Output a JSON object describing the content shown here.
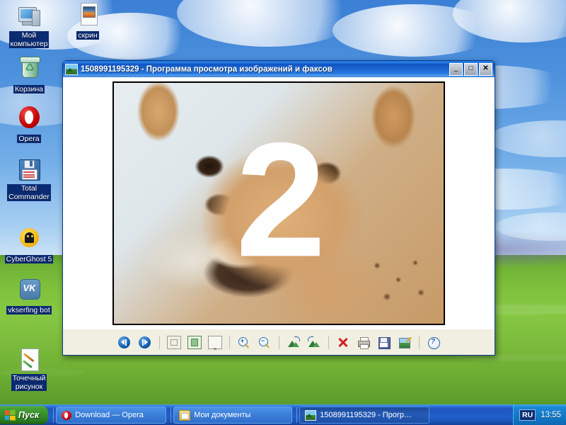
{
  "desktop": {
    "wallpaper_name": "bliss-wallpaper",
    "icons": [
      {
        "label": "Мой\nкомпьютер",
        "label_line1": "Мой",
        "label_line2": "компьютер",
        "icon": "my-computer-icon",
        "name": "desktop-icon-my-computer"
      },
      {
        "label": "скрин",
        "label_line1": "скрин",
        "label_line2": "",
        "icon": "picture-file-icon",
        "name": "desktop-icon-skrin"
      },
      {
        "label": "Корзина",
        "label_line1": "Корзина",
        "label_line2": "",
        "icon": "recycle-bin-icon",
        "name": "desktop-icon-recycle-bin"
      },
      {
        "label": "Opera",
        "label_line1": "Opera",
        "label_line2": "",
        "icon": "opera-icon",
        "name": "desktop-icon-opera"
      },
      {
        "label": "Total Commander",
        "label_line1": "Total",
        "label_line2": "Commander",
        "icon": "total-commander-icon",
        "name": "desktop-icon-total-commander"
      },
      {
        "label": "CyberGhost 5",
        "label_line1": "CyberGhost 5",
        "label_line2": "",
        "icon": "cyberghost-icon",
        "name": "desktop-icon-cyberghost"
      },
      {
        "label": "vkserfing bot",
        "label_line1": "vkserfing bot",
        "label_line2": "",
        "icon": "vk-icon",
        "name": "desktop-icon-vkserfing-bot"
      },
      {
        "label": "Точечный рисунок",
        "label_line1": "Точечный",
        "label_line2": "рисунок",
        "icon": "bitmap-image-icon",
        "name": "desktop-icon-bitmap"
      }
    ]
  },
  "viewer": {
    "title": "1508991195329 - Программа просмотра изображений и факсов",
    "title_icon": "image-viewer-icon",
    "window_buttons": {
      "minimize": "_",
      "maximize": "□",
      "close": "✕"
    },
    "image": {
      "overlay_text": "2",
      "description": "chihuahua-photo"
    },
    "toolbar": [
      {
        "name": "previous-image-button",
        "icon": "previous-icon",
        "tooltip": "Предыдущее изображение"
      },
      {
        "name": "next-image-button",
        "icon": "next-icon",
        "tooltip": "Следующее изображение"
      },
      {
        "name": "best-fit-button",
        "icon": "best-fit-icon",
        "tooltip": "Наилучшее соответствие"
      },
      {
        "name": "actual-size-button",
        "icon": "actual-size-icon",
        "tooltip": "Реальный размер"
      },
      {
        "name": "slideshow-button",
        "icon": "slideshow-icon",
        "tooltip": "Показ слайдов"
      },
      {
        "name": "zoom-in-button",
        "icon": "zoom-in-icon",
        "tooltip": "Увеличить"
      },
      {
        "name": "zoom-out-button",
        "icon": "zoom-out-icon",
        "tooltip": "Уменьшить"
      },
      {
        "name": "rotate-clockwise-button",
        "icon": "rotate-clockwise-icon",
        "tooltip": "Повернуть по часовой стрелке"
      },
      {
        "name": "rotate-counterclockwise-button",
        "icon": "rotate-counterclockwise-icon",
        "tooltip": "Повернуть против часовой стрелки"
      },
      {
        "name": "delete-button",
        "icon": "delete-icon",
        "tooltip": "Удалить"
      },
      {
        "name": "print-button",
        "icon": "print-icon",
        "tooltip": "Печать"
      },
      {
        "name": "save-as-button",
        "icon": "save-icon",
        "tooltip": "Копировать в"
      },
      {
        "name": "edit-button",
        "icon": "edit-image-icon",
        "tooltip": "Изменить рисунок"
      },
      {
        "name": "help-button",
        "icon": "help-icon",
        "tooltip": "Справка"
      }
    ]
  },
  "taskbar": {
    "start_label": "Пуск",
    "start_icon": "windows-flag-icon",
    "buttons": [
      {
        "label": "Download — Opera",
        "icon": "opera-icon",
        "active": false,
        "name": "taskbar-button-opera"
      },
      {
        "label": "Мои документы",
        "icon": "folder-icon",
        "active": false,
        "name": "taskbar-button-my-documents"
      },
      {
        "label": "1508991195329 - Прогр…",
        "icon": "image-viewer-icon",
        "active": true,
        "name": "taskbar-button-image-viewer"
      }
    ],
    "tray": {
      "language": "RU",
      "clock": "13:55"
    }
  },
  "colors": {
    "titlebar_blue": "#1a64cf",
    "taskbar_blue": "#2160c8",
    "start_green": "#338c26",
    "window_face": "#ece9d8",
    "selection_blue": "#0a2a72"
  }
}
